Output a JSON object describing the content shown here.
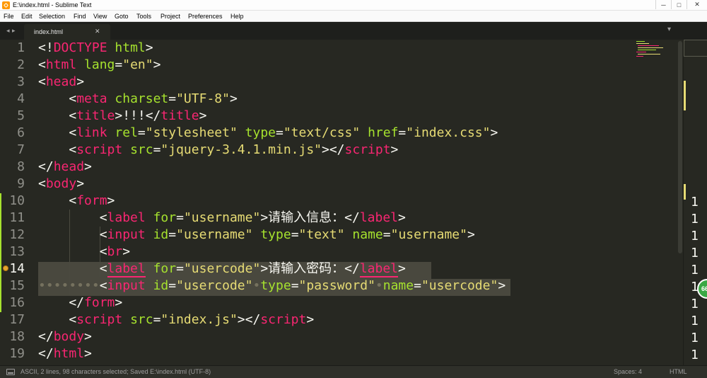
{
  "window": {
    "title": "E:\\index.html - Sublime Text",
    "minimize": "─",
    "maximize": "□",
    "close": "✕"
  },
  "menu": [
    "File",
    "Edit",
    "Selection",
    "Find",
    "View",
    "Goto",
    "Tools",
    "Project",
    "Preferences",
    "Help"
  ],
  "tabbar": {
    "nav_left": "◂",
    "nav_right": "▸",
    "active_tab": "index.html",
    "close_glyph": "✕",
    "dropdown_glyph": "▾"
  },
  "editor": {
    "current_line": 14,
    "line_numbers": [
      "1",
      "2",
      "3",
      "4",
      "5",
      "6",
      "7",
      "8",
      "9",
      "10",
      "11",
      "12",
      "13",
      "14",
      "15",
      "16",
      "17",
      "18",
      "19"
    ],
    "lines": [
      [
        [
          "p",
          "<!"
        ],
        [
          "k",
          "DOCTYPE"
        ],
        [
          "p",
          " "
        ],
        [
          "a",
          "html"
        ],
        [
          "p",
          ">"
        ]
      ],
      [
        [
          "p",
          "<"
        ],
        [
          "t",
          "html"
        ],
        [
          "p",
          " "
        ],
        [
          "a",
          "lang"
        ],
        [
          "p",
          "="
        ],
        [
          "s",
          "\"en\""
        ],
        [
          "p",
          ">"
        ]
      ],
      [
        [
          "p",
          "<"
        ],
        [
          "t",
          "head"
        ],
        [
          "p",
          ">"
        ]
      ],
      [
        [
          "p",
          "    <"
        ],
        [
          "t",
          "meta"
        ],
        [
          "p",
          " "
        ],
        [
          "a",
          "charset"
        ],
        [
          "p",
          "="
        ],
        [
          "s",
          "\"UTF-8\""
        ],
        [
          "p",
          ">"
        ]
      ],
      [
        [
          "p",
          "    <"
        ],
        [
          "t",
          "title"
        ],
        [
          "p",
          ">!!!</"
        ],
        [
          "t",
          "title"
        ],
        [
          "p",
          ">"
        ]
      ],
      [
        [
          "p",
          "    <"
        ],
        [
          "t",
          "link"
        ],
        [
          "p",
          " "
        ],
        [
          "a",
          "rel"
        ],
        [
          "p",
          "="
        ],
        [
          "s",
          "\"stylesheet\""
        ],
        [
          "p",
          " "
        ],
        [
          "a",
          "type"
        ],
        [
          "p",
          "="
        ],
        [
          "s",
          "\"text/css\""
        ],
        [
          "p",
          " "
        ],
        [
          "a",
          "href"
        ],
        [
          "p",
          "="
        ],
        [
          "s",
          "\"index.css\""
        ],
        [
          "p",
          ">"
        ]
      ],
      [
        [
          "p",
          "    <"
        ],
        [
          "t",
          "script"
        ],
        [
          "p",
          " "
        ],
        [
          "a",
          "src"
        ],
        [
          "p",
          "="
        ],
        [
          "s",
          "\"jquery-3.4.1.min.js\""
        ],
        [
          "p",
          "></"
        ],
        [
          "t",
          "script"
        ],
        [
          "p",
          ">"
        ]
      ],
      [
        [
          "p",
          "</"
        ],
        [
          "t",
          "head"
        ],
        [
          "p",
          ">"
        ]
      ],
      [
        [
          "p",
          "<"
        ],
        [
          "t",
          "body"
        ],
        [
          "p",
          ">"
        ]
      ],
      [
        [
          "p",
          "    <"
        ],
        [
          "t",
          "form"
        ],
        [
          "p",
          ">"
        ]
      ],
      [
        [
          "p",
          "        <"
        ],
        [
          "t",
          "label"
        ],
        [
          "p",
          " "
        ],
        [
          "a",
          "for"
        ],
        [
          "p",
          "="
        ],
        [
          "s",
          "\"username\""
        ],
        [
          "p",
          ">请输入信息：</"
        ],
        [
          "t",
          "label"
        ],
        [
          "p",
          ">"
        ]
      ],
      [
        [
          "p",
          "        <"
        ],
        [
          "t",
          "input"
        ],
        [
          "p",
          " "
        ],
        [
          "a",
          "id"
        ],
        [
          "p",
          "="
        ],
        [
          "s",
          "\"username\""
        ],
        [
          "p",
          " "
        ],
        [
          "a",
          "type"
        ],
        [
          "p",
          "="
        ],
        [
          "s",
          "\"text\""
        ],
        [
          "p",
          " "
        ],
        [
          "a",
          "name"
        ],
        [
          "p",
          "="
        ],
        [
          "s",
          "\"username\""
        ],
        [
          "p",
          ">"
        ]
      ],
      [
        [
          "p",
          "        <"
        ],
        [
          "t",
          "br"
        ],
        [
          "p",
          ">"
        ]
      ],
      [
        [
          "p",
          "        <"
        ],
        [
          "tu",
          "label"
        ],
        [
          "p",
          " "
        ],
        [
          "a",
          "for"
        ],
        [
          "p",
          "="
        ],
        [
          "s",
          "\"usercode\""
        ],
        [
          "p",
          ">请输入密码：</"
        ],
        [
          "tu",
          "label"
        ],
        [
          "p",
          ">"
        ]
      ],
      [
        [
          "d",
          "••••••••"
        ],
        [
          "p",
          "<"
        ],
        [
          "t",
          "input"
        ],
        [
          "p",
          " "
        ],
        [
          "a",
          "id"
        ],
        [
          "p",
          "="
        ],
        [
          "s",
          "\"usercode\""
        ],
        [
          "d",
          "•"
        ],
        [
          "a",
          "type"
        ],
        [
          "p",
          "="
        ],
        [
          "s",
          "\"password\""
        ],
        [
          "d",
          "•"
        ],
        [
          "a",
          "name"
        ],
        [
          "p",
          "="
        ],
        [
          "s",
          "\"usercode\""
        ],
        [
          "p",
          ">"
        ]
      ],
      [
        [
          "p",
          "    </"
        ],
        [
          "t",
          "form"
        ],
        [
          "p",
          ">"
        ]
      ],
      [
        [
          "p",
          "    <"
        ],
        [
          "t",
          "script"
        ],
        [
          "p",
          " "
        ],
        [
          "a",
          "src"
        ],
        [
          "p",
          "="
        ],
        [
          "s",
          "\"index.js\""
        ],
        [
          "p",
          "></"
        ],
        [
          "t",
          "script"
        ],
        [
          "p",
          ">"
        ]
      ],
      [
        [
          "p",
          "</"
        ],
        [
          "t",
          "body"
        ],
        [
          "p",
          ">"
        ]
      ],
      [
        [
          "p",
          "</"
        ],
        [
          "t",
          "html"
        ],
        [
          "p",
          ">"
        ]
      ]
    ]
  },
  "right_pane": {
    "line_numbers": [
      "1",
      "1",
      "1",
      "1",
      "1",
      "1",
      "1",
      "1",
      "1",
      "1"
    ]
  },
  "badge": {
    "text": "66"
  },
  "statusbar": {
    "message": "ASCII, 2 lines, 98 characters selected; Saved E:\\index.html (UTF-8)",
    "indentation": "Spaces: 4",
    "syntax": "HTML"
  },
  "colors": {
    "background": "#272822",
    "tag": "#f92672",
    "attribute": "#a6e22e",
    "string": "#e6db74",
    "text": "#f8f8f2",
    "line_number": "#90908a",
    "selection": "#49483e"
  }
}
